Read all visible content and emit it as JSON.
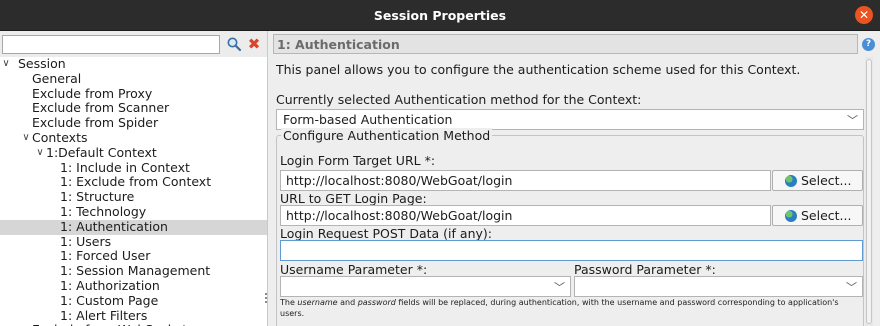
{
  "window": {
    "title": "Session Properties"
  },
  "tree": {
    "items": [
      {
        "label": "Session",
        "indent": 0,
        "arrow": "v"
      },
      {
        "label": "General",
        "indent": 1,
        "arrow": ""
      },
      {
        "label": "Exclude from Proxy",
        "indent": 1,
        "arrow": ""
      },
      {
        "label": "Exclude from Scanner",
        "indent": 1,
        "arrow": ""
      },
      {
        "label": "Exclude from Spider",
        "indent": 1,
        "arrow": ""
      },
      {
        "label": "Contexts",
        "indent": 1,
        "arrow": "v"
      },
      {
        "label": "1:Default Context",
        "indent": 2,
        "arrow": "v"
      },
      {
        "label": "1: Include in Context",
        "indent": 3,
        "arrow": ""
      },
      {
        "label": "1: Exclude from Context",
        "indent": 3,
        "arrow": ""
      },
      {
        "label": "1: Structure",
        "indent": 3,
        "arrow": ""
      },
      {
        "label": "1: Technology",
        "indent": 3,
        "arrow": ""
      },
      {
        "label": "1: Authentication",
        "indent": 3,
        "arrow": "",
        "selected": true
      },
      {
        "label": "1: Users",
        "indent": 3,
        "arrow": ""
      },
      {
        "label": "1: Forced User",
        "indent": 3,
        "arrow": ""
      },
      {
        "label": "1: Session Management",
        "indent": 3,
        "arrow": ""
      },
      {
        "label": "1: Authorization",
        "indent": 3,
        "arrow": ""
      },
      {
        "label": "1: Custom Page",
        "indent": 3,
        "arrow": ""
      },
      {
        "label": "1: Alert Filters",
        "indent": 3,
        "arrow": ""
      },
      {
        "label": "Exclude from WebSockets",
        "indent": 1,
        "arrow": ""
      }
    ]
  },
  "panel": {
    "header": "1: Authentication",
    "description": "This panel allows you to configure the authentication scheme used for this Context.",
    "method_label": "Currently selected Authentication method for the Context:",
    "method_value": "Form-based Authentication",
    "group_title": "Configure Authentication Method",
    "login_target_label": "Login Form Target URL *:",
    "login_target_value": "http://localhost:8080/WebGoat/login",
    "login_page_label": "URL to GET Login Page:",
    "login_page_value": "http://localhost:8080/WebGoat/login",
    "select_label": "Select...",
    "post_data_label": "Login Request POST Data (if any):",
    "post_data_value": "",
    "username_label": "Username Parameter *:",
    "password_label": "Password Parameter *:",
    "username_value": "",
    "password_value": "",
    "note_part1": "The ",
    "note_username": "username",
    "note_part2": " and ",
    "note_password": "password",
    "note_part3": " fields will be replaced, during authentication, with the username and password corresponding to application's users."
  },
  "colors": {
    "titlebar": "#2c2c2c",
    "close": "#e95420",
    "selected": "#d6d6d6",
    "focus": "#5f9ad3"
  }
}
